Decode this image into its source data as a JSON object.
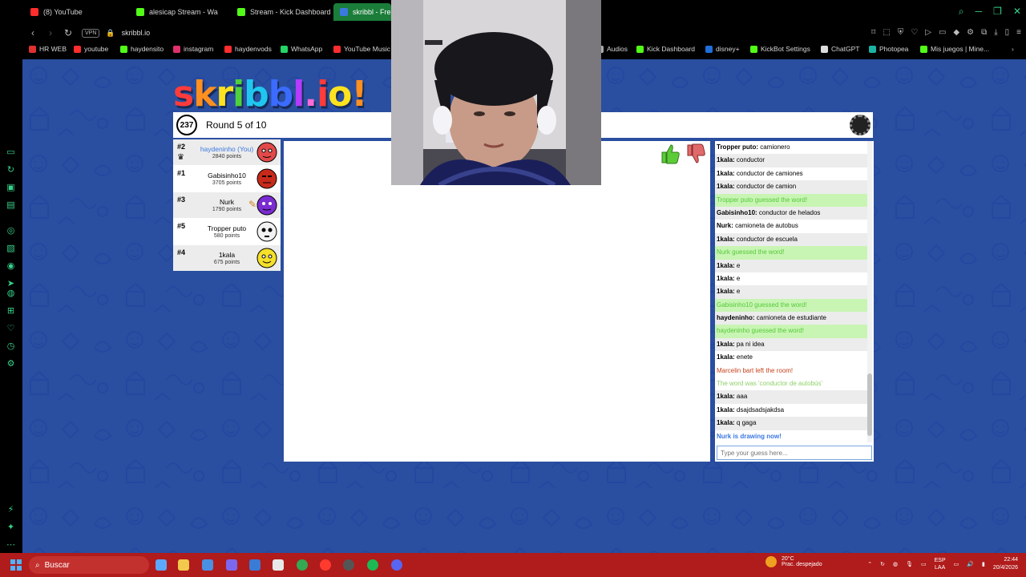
{
  "browser": {
    "tabs": [
      {
        "label": "(8) YouTube",
        "color": "#ff2d2d"
      },
      {
        "label": "alesicap Stream - Wa",
        "color": "#53fc18"
      },
      {
        "label": "Stream - Kick Dashboard",
        "color": "#53fc18"
      },
      {
        "label": "skribbl - Free",
        "color": "#3b78e0",
        "active": true
      }
    ],
    "url": "skribbl.io",
    "vpn_label": "VPN",
    "bookmarks": [
      {
        "label": "HR WEB",
        "color": "#e03030"
      },
      {
        "label": "youtube",
        "color": "#ff2d2d"
      },
      {
        "label": "haydensito",
        "color": "#53fc18"
      },
      {
        "label": "instagram",
        "color": "#e1306c"
      },
      {
        "label": "haydenvods",
        "color": "#ff2d2d"
      },
      {
        "label": "WhatsApp",
        "color": "#25d366"
      },
      {
        "label": "YouTube Music",
        "color": "#ff2d2d"
      },
      {
        "label": "Audios",
        "color": "#aaaaaa"
      },
      {
        "label": "Kick Dashboard",
        "color": "#53fc18"
      },
      {
        "label": "disney+",
        "color": "#1e6fd9"
      },
      {
        "label": "KickBot Settings",
        "color": "#53fc18"
      },
      {
        "label": "ChatGPT",
        "color": "#dddddd"
      },
      {
        "label": "Photopea",
        "color": "#1bb3a4"
      },
      {
        "label": "Mis juegos | Mine...",
        "color": "#53fc18"
      }
    ]
  },
  "game": {
    "logo": "skribbl.io",
    "timer": "237",
    "round_text": "Round 5 of 10",
    "players": [
      {
        "rank": "#2",
        "name": "haydeninho (You)",
        "points": "2840 points",
        "you": true,
        "avatar_color": "#e24a4a"
      },
      {
        "rank": "#1",
        "name": "Gabisinho10",
        "points": "3705 points",
        "you": false,
        "avatar_color": "#c72a1a"
      },
      {
        "rank": "#3",
        "name": "Nurk",
        "points": "1790 points",
        "you": false,
        "avatar_color": "#7a2bd1"
      },
      {
        "rank": "#5",
        "name": "Tropper puto",
        "points": "580 points",
        "you": false,
        "avatar_color": "#f2f2f2"
      },
      {
        "rank": "#4",
        "name": "1kala",
        "points": "675 points",
        "you": false,
        "avatar_color": "#f5e02a"
      }
    ],
    "chat": [
      {
        "who": "Tropper puto:",
        "text": "camionero",
        "type": "normal"
      },
      {
        "who": "1kala:",
        "text": "conductor",
        "type": "normal"
      },
      {
        "who": "1kala:",
        "text": "conductor de camiones",
        "type": "normal"
      },
      {
        "who": "1kala:",
        "text": "conductor de camion",
        "type": "normal"
      },
      {
        "who": "",
        "text": "Tropper puto guessed the word!",
        "type": "guess"
      },
      {
        "who": "Gabisinho10:",
        "text": "conductor de helados",
        "type": "normal"
      },
      {
        "who": "Nurk:",
        "text": "camioneta de autobus",
        "type": "normal"
      },
      {
        "who": "1kala:",
        "text": "conductor de escuela",
        "type": "normal"
      },
      {
        "who": "",
        "text": "Nurk guessed the word!",
        "type": "guess"
      },
      {
        "who": "1kala:",
        "text": "e",
        "type": "normal"
      },
      {
        "who": "1kala:",
        "text": "e",
        "type": "normal"
      },
      {
        "who": "1kala:",
        "text": "e",
        "type": "normal"
      },
      {
        "who": "",
        "text": "Gabisinho10 guessed the word!",
        "type": "guess"
      },
      {
        "who": "haydeninho:",
        "text": "camioneta de estudiante",
        "type": "normal"
      },
      {
        "who": "",
        "text": "haydeninho guessed the word!",
        "type": "guess"
      },
      {
        "who": "1kala:",
        "text": "pa ni idea",
        "type": "normal"
      },
      {
        "who": "1kala:",
        "text": "enete",
        "type": "normal"
      },
      {
        "who": "",
        "text": "Marcelin bart left the room!",
        "type": "leave"
      },
      {
        "who": "",
        "text": "The word was 'conductor de autobús'",
        "type": "word"
      },
      {
        "who": "1kala:",
        "text": "aaa",
        "type": "normal"
      },
      {
        "who": "1kala:",
        "text": "dsajdsadsjakdsa",
        "type": "normal"
      },
      {
        "who": "1kala:",
        "text": "q gaga",
        "type": "normal"
      },
      {
        "who": "",
        "text": "Nurk is drawing now!",
        "type": "draw"
      }
    ],
    "guess_placeholder": "Type your guess here..."
  },
  "taskbar": {
    "search_label": "Buscar",
    "weather_temp": "20°C",
    "weather_desc": "Prac. despejado",
    "lang": "ESP",
    "lang_sub": "LAA",
    "time": "22:44",
    "date": "20/4/2026"
  },
  "colors": {
    "page_bg": "#2a4fa0",
    "taskbar": "#b01b1b",
    "accent_green": "#37d18a"
  }
}
